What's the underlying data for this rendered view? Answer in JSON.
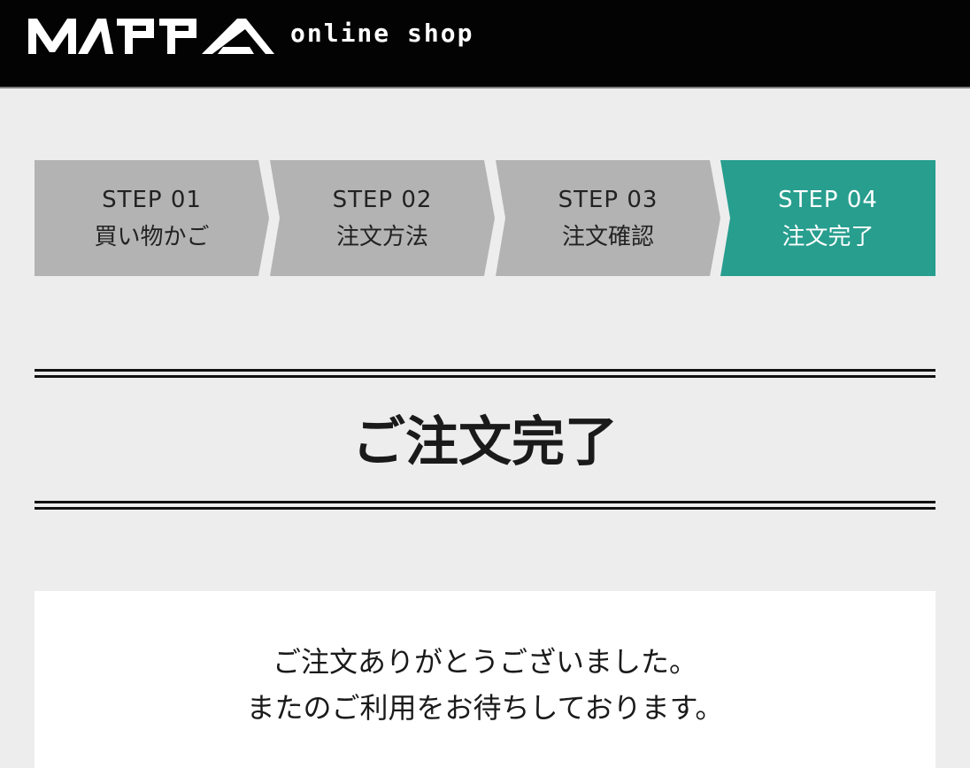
{
  "header": {
    "logo_text": "MAPPA",
    "logo_subtitle": "online shop",
    "background": "#030303"
  },
  "steps": [
    {
      "number": "STEP 01",
      "label": "買い物かご",
      "active": false
    },
    {
      "number": "STEP 02",
      "label": "注文方法",
      "active": false
    },
    {
      "number": "STEP 03",
      "label": "注文確認",
      "active": false
    },
    {
      "number": "STEP 04",
      "label": "注文完了",
      "active": true
    }
  ],
  "colors": {
    "step_inactive": "#b3b3b3",
    "step_active": "#279e8e",
    "page_background": "#ededed"
  },
  "page_title": "ご注文完了",
  "message": {
    "line1": "ご注文ありがとうございました。",
    "line2": "またのご利用をお待ちしております。"
  }
}
